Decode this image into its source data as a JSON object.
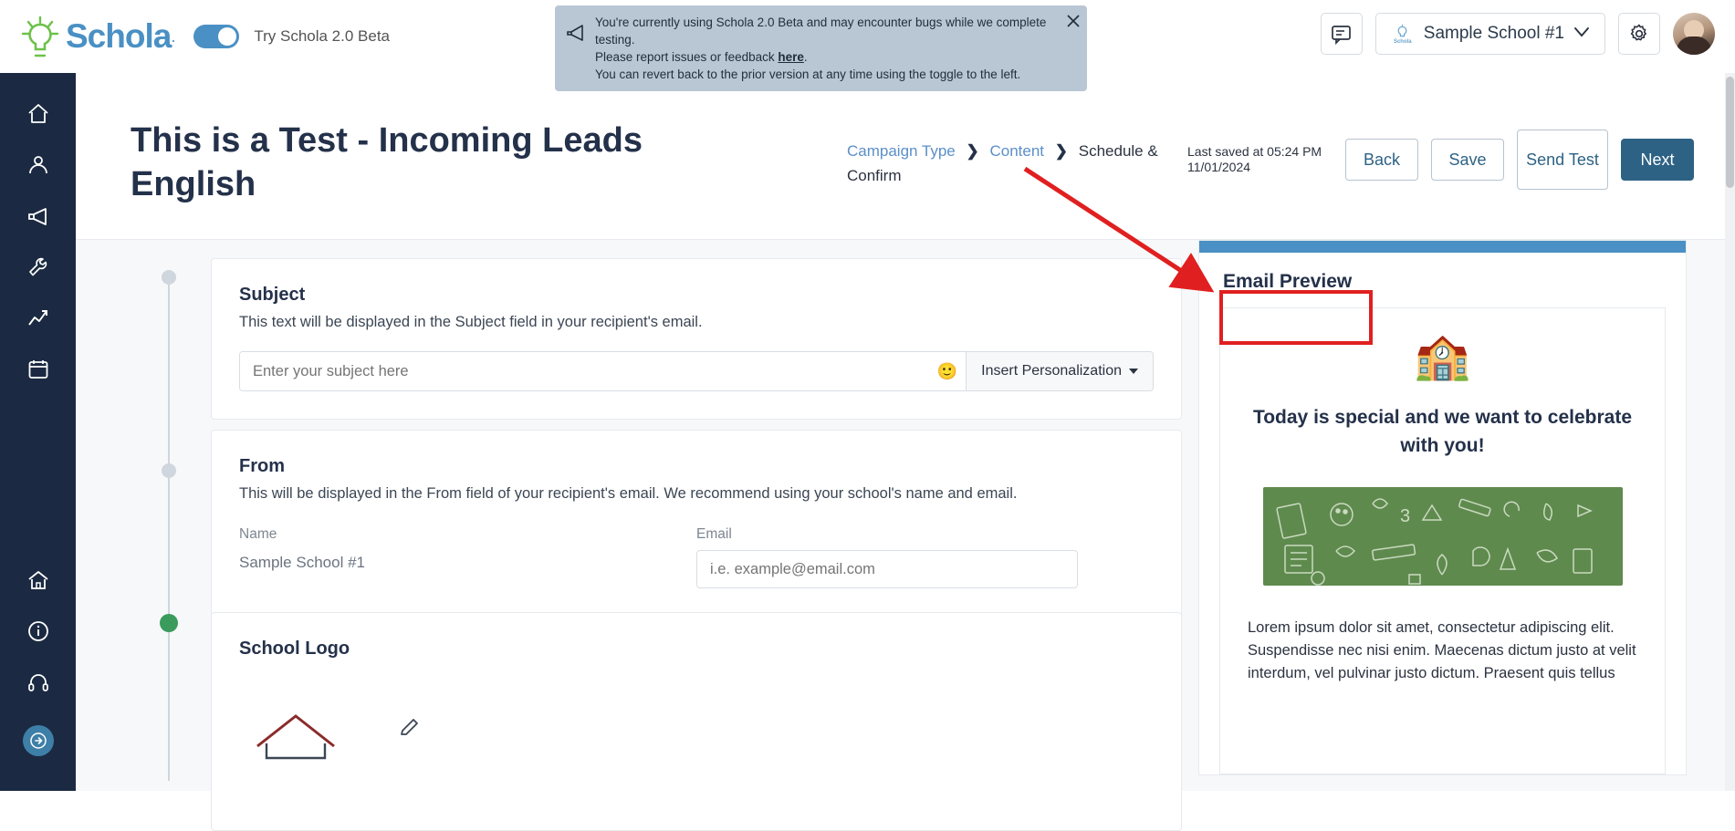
{
  "brand": {
    "name": "Schola",
    "accent": "#4a90c4",
    "dark": "#1b2a42",
    "primary_button": "#2d6285"
  },
  "topbar": {
    "beta_toggle_label": "Try Schola 2.0 Beta",
    "banner": {
      "line1": "You're currently using Schola 2.0 Beta and may encounter bugs while we complete testing.",
      "line2_prefix": "Please report issues or feedback ",
      "line2_link": "here",
      "line2_suffix": ".",
      "line3": "You can revert back to the prior version at any time using the toggle to the left."
    },
    "school_selector": "Sample School #1"
  },
  "sidebar": {
    "items": [
      {
        "name": "home",
        "icon": "home-icon"
      },
      {
        "name": "students",
        "icon": "people-icon"
      },
      {
        "name": "campaigns",
        "icon": "megaphone-icon"
      },
      {
        "name": "tools",
        "icon": "wrench-icon"
      },
      {
        "name": "analytics",
        "icon": "chart-icon"
      },
      {
        "name": "calendar",
        "icon": "calendar-icon"
      },
      {
        "name": "school",
        "icon": "school-building-icon"
      },
      {
        "name": "info",
        "icon": "info-icon"
      },
      {
        "name": "support",
        "icon": "headset-icon"
      }
    ],
    "expand_label": "expand-sidebar"
  },
  "page": {
    "title": "This is a Test - Incoming Leads English",
    "breadcrumb": [
      {
        "label": "Campaign Type",
        "current": false
      },
      {
        "label": "Content",
        "current": false
      },
      {
        "label": "Schedule & Confirm",
        "current": true
      }
    ],
    "saved_line1": "Last saved at 05:24 PM",
    "saved_line2": "11/01/2024",
    "buttons": {
      "back": "Back",
      "save": "Save",
      "send_test": "Send Test",
      "next": "Next"
    }
  },
  "subject_card": {
    "title": "Subject",
    "description": "This text will be displayed in the Subject field in your recipient's email.",
    "input_placeholder": "Enter your subject here",
    "input_value": "",
    "emoji_button": "🙂",
    "personalization_label": "Insert Personalization"
  },
  "from_card": {
    "title": "From",
    "description": "This will be displayed in the From field of your recipient's email. We recommend using your school's name and email.",
    "name_label": "Name",
    "name_value": "Sample School #1",
    "email_label": "Email",
    "email_placeholder": "i.e. example@email.com",
    "email_value": ""
  },
  "logo_card": {
    "title": "School Logo"
  },
  "preview": {
    "title": "Email Preview",
    "school_emoji": "🏫",
    "headline": "Today is special and we want to celebrate with you!",
    "body": "Lorem ipsum dolor sit amet, consectetur adipiscing elit. Suspendisse nec nisi enim. Maecenas dictum justo at velit interdum, vel pulvinar justo dictum. Praesent quis tellus",
    "hero_color": "#5f8a4e"
  },
  "annotation": {
    "color": "#e02020",
    "target": "Email Preview"
  }
}
